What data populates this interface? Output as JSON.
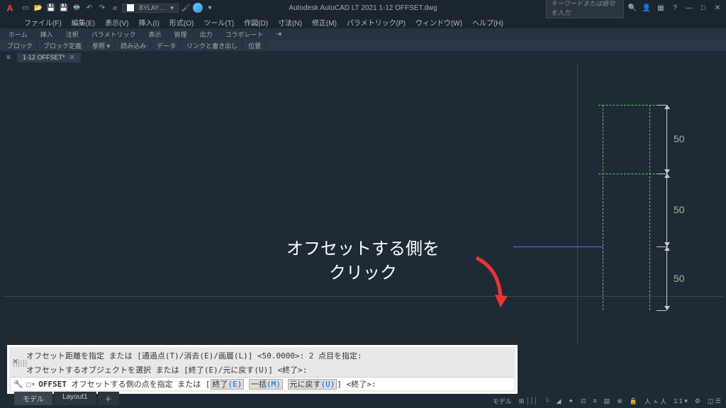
{
  "title": "Autodesk AutoCAD LT 2021  1-12 OFFSET.dwg",
  "search_placeholder": "キーワードまたは語句を入力",
  "bylay": "BYLAY…",
  "menubar": [
    "ファイル(F)",
    "編集(E)",
    "表示(V)",
    "挿入(I)",
    "形式(O)",
    "ツール(T)",
    "作図(D)",
    "寸法(N)",
    "修正(M)",
    "パラメトリック(P)",
    "ウィンドウ(W)",
    "ヘルプ(H)"
  ],
  "ribbon_tabs": [
    "ホーム",
    "挿入",
    "注釈",
    "パラメトリック",
    "表示",
    "管理",
    "出力",
    "コラボレート"
  ],
  "ribbon_panels": [
    "ブロック",
    "ブロック定義",
    "参照 ▾",
    "読み込み",
    "データ",
    "リンクと書き出し",
    "位置"
  ],
  "file_tab": "1-12 OFFSET*",
  "dims": {
    "d1": "50",
    "d2": "50",
    "d3": "50"
  },
  "annotation": {
    "line1": "オフセットする側を",
    "line2": "クリック"
  },
  "cmd": {
    "hist1": "オフセット距離を指定 または [通過点(T)/消去(E)/画層(L)] <50.0000>:  2 点目を指定:",
    "hist2": "オフセットするオブジェクトを選択 または [終了(E)/元に戻す(U)] <終了>:",
    "prompt_cmd": "OFFSET",
    "prompt_txt1": " オフセットする側の点を指定 または [",
    "opt1": "終了",
    "opt1k": "(E)",
    "opt2": "一括",
    "opt2k": "(M)",
    "opt3": "元に戻す",
    "opt3k": "(U)",
    "prompt_txt2": "] <終了>:"
  },
  "layout_tabs": {
    "model": "モデル",
    "layout1": "Layout1",
    "plus": "＋"
  },
  "statusbar": {
    "model": "モデル",
    "scale": "1:1 ▾"
  },
  "window_controls": {
    "min": "—",
    "max": "□",
    "close": "✕"
  }
}
